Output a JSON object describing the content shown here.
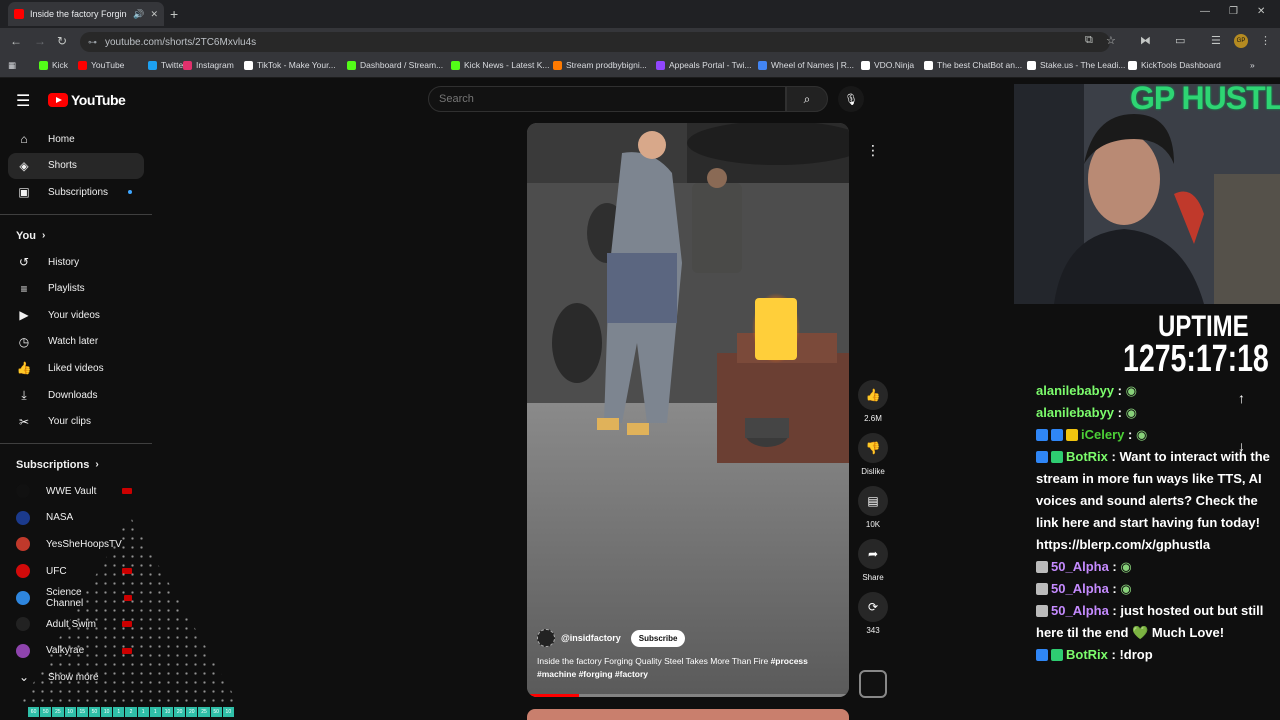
{
  "browser": {
    "tab_title": "Inside the factory Forging Q",
    "url": "youtube.com/shorts/2TC6Mxvlu4s",
    "profile_initials": "GP",
    "bookmarks": [
      {
        "label": "Kick",
        "color": "#53fc18"
      },
      {
        "label": "YouTube",
        "color": "#ff0000"
      },
      {
        "label": "Twitter",
        "color": "#1da1f2"
      },
      {
        "label": "Instagram",
        "color": "#e1306c"
      },
      {
        "label": "TikTok - Make Your...",
        "color": "#ffffff"
      },
      {
        "label": "Dashboard / Stream...",
        "color": "#53fc18"
      },
      {
        "label": "Kick News - Latest K...",
        "color": "#53fc18"
      },
      {
        "label": "Stream prodbybigni...",
        "color": "#ff7a00"
      },
      {
        "label": "Appeals Portal - Twi...",
        "color": "#9146ff"
      },
      {
        "label": "Wheel of Names | R...",
        "color": "#4285f4"
      },
      {
        "label": "VDO.Ninja",
        "color": "#ffffff"
      },
      {
        "label": "The best ChatBot an...",
        "color": "#ffffff"
      },
      {
        "label": "Stake.us - The Leadi...",
        "color": "#ffffff"
      },
      {
        "label": "KickTools Dashboard",
        "color": "#ffffff"
      }
    ]
  },
  "youtube": {
    "logo_text": "YouTube",
    "search_placeholder": "Search",
    "nav": [
      {
        "label": "Home",
        "icon": "home-icon",
        "glyph": "⌂",
        "active": false
      },
      {
        "label": "Shorts",
        "icon": "shorts-icon",
        "glyph": "◈",
        "active": true
      },
      {
        "label": "Subscriptions",
        "icon": "subscriptions-icon",
        "glyph": "▣",
        "active": false
      }
    ],
    "you_heading": "You",
    "you_items": [
      {
        "label": "History",
        "icon": "history-icon",
        "glyph": "↺"
      },
      {
        "label": "Playlists",
        "icon": "playlists-icon",
        "glyph": "≡"
      },
      {
        "label": "Your videos",
        "icon": "your-videos-icon",
        "glyph": "▶"
      },
      {
        "label": "Watch later",
        "icon": "watch-later-icon",
        "glyph": "◷"
      },
      {
        "label": "Liked videos",
        "icon": "liked-videos-icon",
        "glyph": "👍"
      },
      {
        "label": "Downloads",
        "icon": "downloads-icon",
        "glyph": "⤓"
      },
      {
        "label": "Your clips",
        "icon": "clips-icon",
        "glyph": "✂"
      }
    ],
    "subscriptions_heading": "Subscriptions",
    "subscriptions": [
      {
        "label": "WWE Vault",
        "color": "#111111",
        "live": true
      },
      {
        "label": "NASA",
        "color": "#1b3a8c",
        "live": false
      },
      {
        "label": "YesSheHoopsTV",
        "color": "#c0392b",
        "live": true
      },
      {
        "label": "UFC",
        "color": "#d20a0a",
        "live": true
      },
      {
        "label": "Science Channel",
        "color": "#2e86de",
        "live": true
      },
      {
        "label": "Adult Swim",
        "color": "#222222",
        "live": true
      },
      {
        "label": "Valkyrae",
        "color": "#8e44ad",
        "live": true
      }
    ],
    "show_more": "Show more"
  },
  "short": {
    "channel": "@insidfactory",
    "subscribe_label": "Subscribe",
    "title": "Inside the factory Forging Quality Steel Takes More Than Fire",
    "hashtags": "#process #machine #forging #factory",
    "progress": 0.16,
    "likes": "2.6M",
    "dislike_label": "Dislike",
    "comments": "10K",
    "share_label": "Share",
    "remixes": "343"
  },
  "stream": {
    "channel_title": "GP HUSTLA",
    "uptime_label": "UPTIME",
    "uptime_value": "1275:17:18",
    "chat": [
      {
        "user": "alanilebabyy",
        "color": "#7cfc6c",
        "text": "",
        "badges": []
      },
      {
        "user": "alanilebabyy",
        "color": "#7cfc6c",
        "text": "",
        "badges": []
      },
      {
        "user": "iCelery",
        "color": "#4cd137",
        "text": "",
        "badges": [
          "#2f86f6",
          "#2f86f6",
          "#f1c40f"
        ]
      },
      {
        "user": "BotRix",
        "color": "#7cfc6c",
        "text": "Want to interact with the stream in more fun ways like TTS, AI voices and sound alerts? Check the link here and start having fun today! https://blerp.com/x/gphustla",
        "badges": [
          "#2f86f6",
          "#2ecc71"
        ]
      },
      {
        "user": "50_Alpha",
        "color": "#c58bff",
        "text": "",
        "badges": [
          "#bbbbbb"
        ]
      },
      {
        "user": "50_Alpha",
        "color": "#c58bff",
        "text": "",
        "badges": [
          "#bbbbbb"
        ]
      },
      {
        "user": "50_Alpha",
        "color": "#c58bff",
        "text": "just hosted out but still here til the end 💚 Much Love!",
        "badges": [
          "#bbbbbb"
        ]
      },
      {
        "user": "BotRix",
        "color": "#7cfc6c",
        "text": "!drop",
        "badges": [
          "#2f86f6",
          "#2ecc71"
        ]
      }
    ]
  },
  "sidebar_strip": [
    "60",
    "50",
    "25",
    "10",
    "15",
    "50",
    "10",
    "1",
    "2",
    "1",
    "1",
    "10",
    "20",
    "20",
    "25",
    "50",
    "10"
  ]
}
